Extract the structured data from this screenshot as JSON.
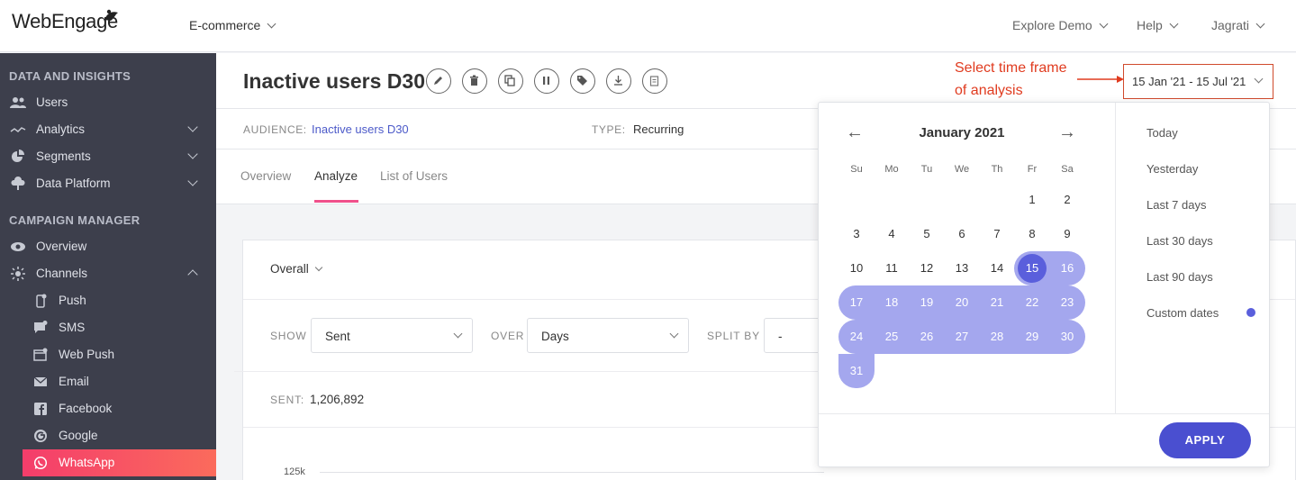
{
  "topbar": {
    "logo_text": "WebEngage",
    "project": "E-commerce",
    "explore_demo": "Explore Demo",
    "help": "Help",
    "user": "Jagrati"
  },
  "sidebar": {
    "section1": "DATA AND INSIGHTS",
    "items1": [
      {
        "label": "Users",
        "icon": "users-icon"
      },
      {
        "label": "Analytics",
        "icon": "analytics-icon"
      },
      {
        "label": "Segments",
        "icon": "pie-icon"
      },
      {
        "label": "Data Platform",
        "icon": "cloud-icon"
      }
    ],
    "section2": "CAMPAIGN MANAGER",
    "items2": [
      {
        "label": "Overview",
        "icon": "eye-icon"
      },
      {
        "label": "Channels",
        "icon": "channels-icon"
      }
    ],
    "channels": [
      {
        "label": "Push",
        "icon": "push-icon"
      },
      {
        "label": "SMS",
        "icon": "sms-icon"
      },
      {
        "label": "Web Push",
        "icon": "web-push-icon"
      },
      {
        "label": "Email",
        "icon": "email-icon"
      },
      {
        "label": "Facebook",
        "icon": "facebook-icon"
      },
      {
        "label": "Google",
        "icon": "google-icon"
      },
      {
        "label": "WhatsApp",
        "icon": "whatsapp-icon"
      }
    ]
  },
  "header": {
    "title": "Inactive users D30"
  },
  "meta": {
    "audience_label": "AUDIENCE:",
    "audience_value": "Inactive users D30",
    "type_label": "TYPE:",
    "type_value": "Recurring"
  },
  "tabs": [
    "Overview",
    "Analyze",
    "List of Users"
  ],
  "card": {
    "overall": "Overall",
    "show_label": "SHOW",
    "show_value": "Sent",
    "over_label": "OVER",
    "over_value": "Days",
    "split_label": "SPLIT BY",
    "split_value": "-",
    "sent_label": "SENT:",
    "sent_value": "1,206,892",
    "ytick": "125k"
  },
  "annotation": {
    "line1": "Select time frame",
    "line2": "of analysis"
  },
  "daterange": "15 Jan '21 - 15 Jul '21",
  "calendar": {
    "prev": "←",
    "next": "→",
    "month": "January 2021",
    "weekdays": [
      "Su",
      "Mo",
      "Tu",
      "We",
      "Th",
      "Fr",
      "Sa"
    ],
    "rows": [
      [
        "",
        "",
        "",
        "",
        "",
        "1",
        "2"
      ],
      [
        "3",
        "4",
        "5",
        "6",
        "7",
        "8",
        "9"
      ],
      [
        "10",
        "11",
        "12",
        "13",
        "14",
        "15",
        "16"
      ],
      [
        "17",
        "18",
        "19",
        "20",
        "21",
        "22",
        "23"
      ],
      [
        "24",
        "25",
        "26",
        "27",
        "28",
        "29",
        "30"
      ],
      [
        "31",
        "",
        "",
        "",
        "",
        "",
        ""
      ]
    ],
    "selected_day": "15",
    "range_color": "#a4a7ee",
    "selected_color": "#5a5fdc"
  },
  "quick_ranges": [
    "Today",
    "Yesterday",
    "Last 7 days",
    "Last 30 days",
    "Last 90 days",
    "Custom dates"
  ],
  "apply_label": "APPLY",
  "colors": {
    "accent": "#4a4fd0",
    "active_nav": "#f43d6b",
    "annotation": "#e03b1f"
  }
}
